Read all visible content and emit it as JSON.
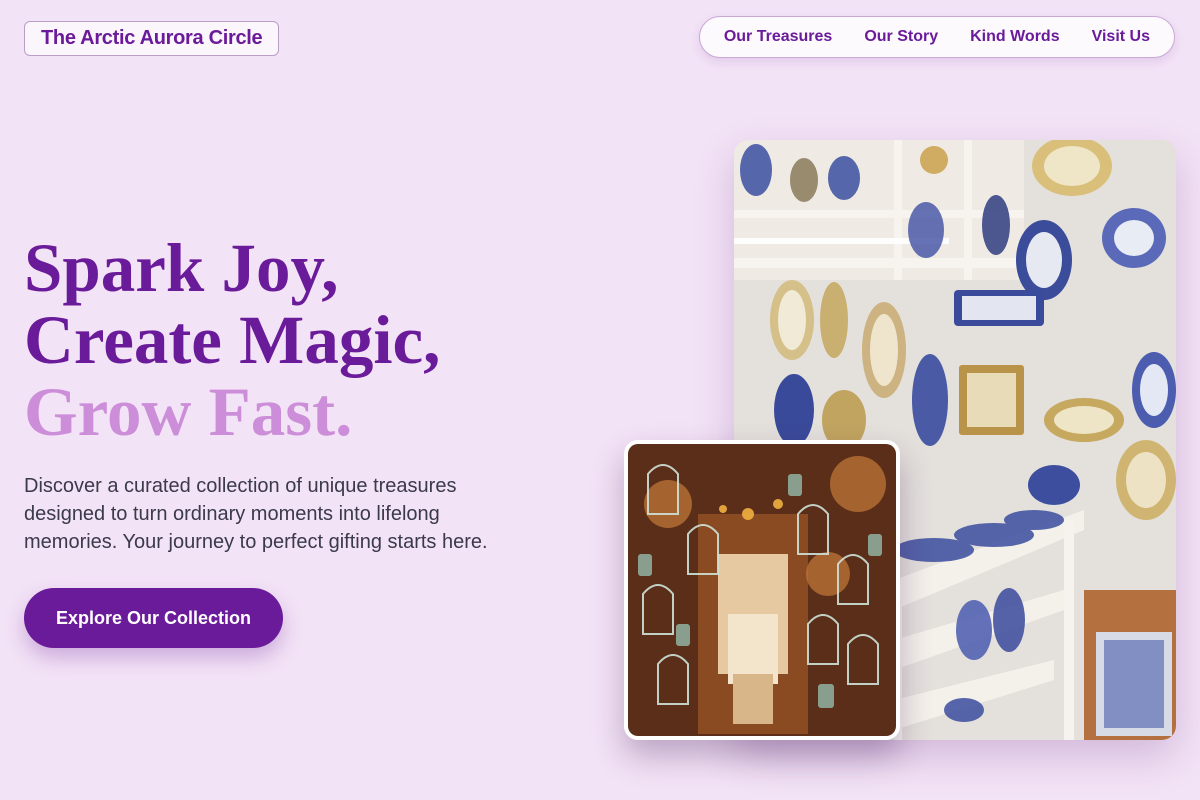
{
  "header": {
    "brand": "The Arctic Aurora Circle",
    "nav": [
      {
        "label": "Our Treasures"
      },
      {
        "label": "Our Story"
      },
      {
        "label": "Kind Words"
      },
      {
        "label": "Visit Us"
      }
    ]
  },
  "hero": {
    "title_line1": "Spark Joy,",
    "title_line2": "Create Magic,",
    "title_line3": "Grow Fast.",
    "description": "Discover a curated collection of unique treasures designed to turn ordinary moments into lifelong memories. Your journey to perfect gifting starts here.",
    "cta_label": "Explore Our Collection"
  },
  "colors": {
    "background": "#f3e3f6",
    "accent": "#6a1b9a",
    "accent_light": "#cc8ed9",
    "text": "#3a3a4a"
  },
  "images": {
    "main_photo": "ceramic-shop-photo",
    "inset_photo": "birdcage-lantern-shop-photo"
  }
}
